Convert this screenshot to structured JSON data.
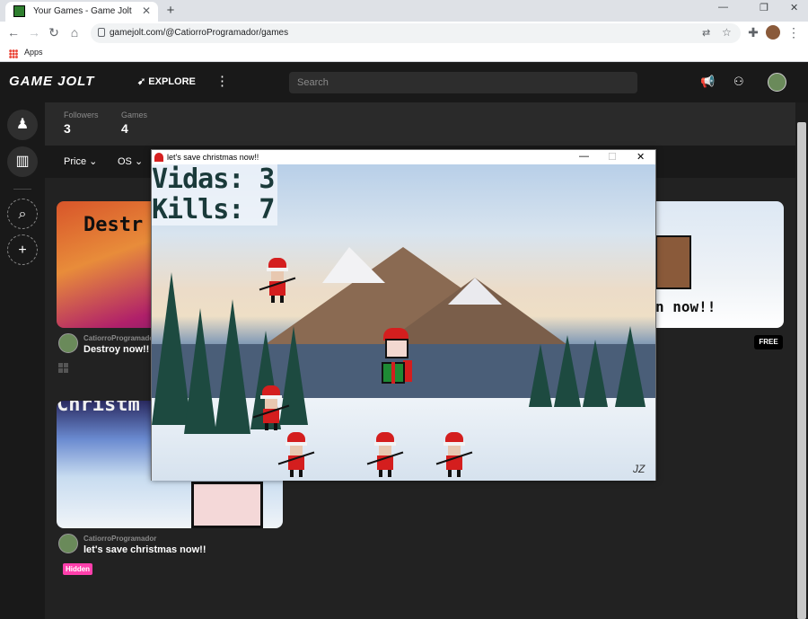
{
  "browser": {
    "tab_title": "Your Games - Game Jolt",
    "tab_close": "✕",
    "new_tab": "+",
    "url": "gamejolt.com/@CatiorroProgramador/games",
    "bookmark_apps": "Apps"
  },
  "header": {
    "logo": "GAME JOLT",
    "explore": "EXPLORE",
    "search_placeholder": "Search"
  },
  "stats": {
    "followers_label": "Followers",
    "followers_value": "3",
    "games_label": "Games",
    "games_value": "4"
  },
  "filters": {
    "price": "Price",
    "os": "OS"
  },
  "games": [
    {
      "thumb_text": "Destr",
      "owner": "CatiorroProgramador",
      "title": "Destroy now!!"
    },
    {
      "thumb_text": "Christm",
      "owner": "CatiorroProgramador",
      "title": "let's save christmas now!!",
      "badge": "Hidden"
    },
    {
      "thumb_text": "n now!!",
      "badge": "FREE"
    }
  ],
  "game_window": {
    "title": "let's save christmas now!!",
    "hud_lives": "Vidas: 3",
    "hud_kills": "Kills: 7",
    "signature": "JZ"
  }
}
